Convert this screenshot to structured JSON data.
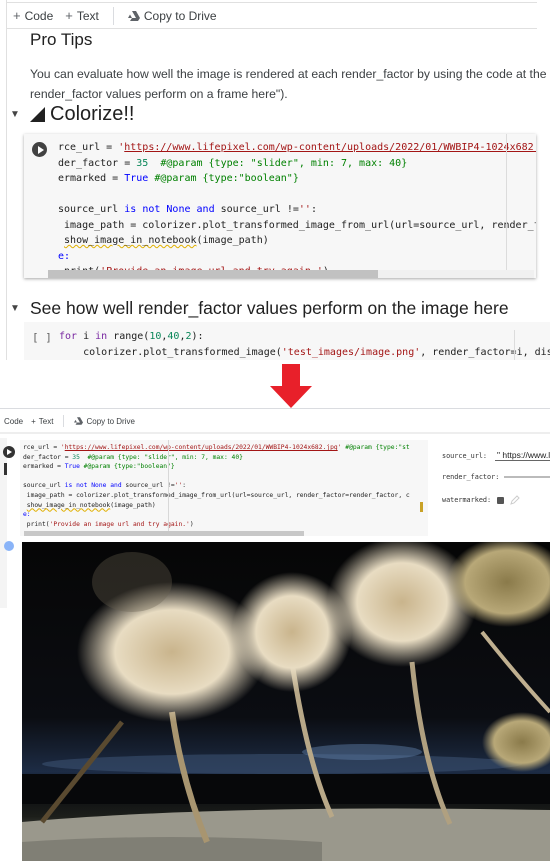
{
  "toolbar": {
    "code_label": "Code",
    "text_label": "Text",
    "copy_label": "Copy to Drive",
    "plus_glyph": "+"
  },
  "pro_tips": {
    "title": "Pro Tips",
    "line1": "You can evaluate how well the image is rendered at each render_factor by using the code at the",
    "line2": "render_factor values perform on a frame here\")."
  },
  "sections": {
    "colorize_title": "Colorize!!",
    "render_title": "See how well render_factor values perform on the image here"
  },
  "code_cell_1": {
    "l1_var": "rce_url = ",
    "l1_q": "'",
    "l1_url": "https://www.lifepixel.com/wp-content/uploads/2022/01/WWBIP4-1024x682.jpg",
    "l2_var": "der_factor = ",
    "l2_num": "35",
    "l2_cmt": "  #@param {type: \"slider\", min: 7, max: 40}",
    "l3_var": "ermarked = ",
    "l3_kw": "True",
    "l3_cmt": " #@param {type:\"boolean\"}",
    "l5_a": "source_url ",
    "l5_is": "is",
    "l5_not": "not",
    "l5_none": "None",
    "l5_and": "and",
    "l5_b": " source_url !=",
    "l5_str": "''",
    "l5_c": ":",
    "l6": " image_path = colorizer.plot_transformed_image_from_url(url=source_url, render_factor=render_factor, c",
    "l7_fn": "show_image_in_notebook",
    "l7_rest": "(image_path)",
    "l8": "e:",
    "l9_a": " print(",
    "l9_str": "'Provide an image url and try again.'",
    "l9_b": ")"
  },
  "code_cell_2": {
    "run_label": "[ ]",
    "l1_for": "for",
    "l1_i": " i ",
    "l1_in": "in",
    "l1_range": " range(",
    "l1_args": [
      "10",
      "40",
      "2"
    ],
    "l1_end": "):",
    "l2_a": "    colorizer.plot_transformed_image(",
    "l2_str": "'test_images/image.png'",
    "l2_b": ", render_factor=i, disp"
  },
  "bottom": {
    "toolbar_code": "Code",
    "toolbar_text": "Text",
    "toolbar_copy": "Copy to Drive",
    "l1_tail": " #@param {type:\"st",
    "form": {
      "source_url_label": "source_url:",
      "source_url_value": "\" https://www.l",
      "render_factor_label": "render_factor:",
      "watermarked_label": "watermarked:",
      "watermarked_checked": true
    },
    "photo_alt": "Colorized photo of palm trees on a beach at night"
  },
  "colors": {
    "arrow": "#e8202a",
    "code_bg": "#f7f7f7",
    "keyword": "#7928a1",
    "builtin": "#0000ff",
    "number": "#098658",
    "string": "#a31515",
    "comment": "#008000"
  }
}
